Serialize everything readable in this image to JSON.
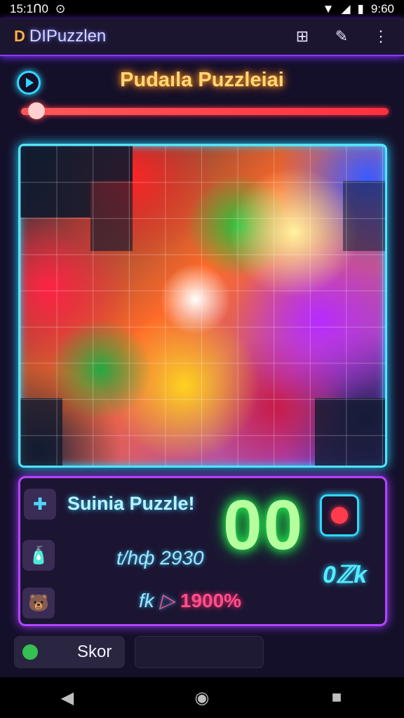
{
  "status_bar": {
    "time": "15:1ᑎ0",
    "right_time": "9:60"
  },
  "app_bar": {
    "logo_text": "D",
    "title": "DIPuzzlen"
  },
  "header": {
    "title": "Pudaıla Puzzleiai"
  },
  "progress": {
    "level": 0.02
  },
  "info_panel": {
    "title": "Suinia Puzzle!",
    "score": "00",
    "line1": "t/hф 2930",
    "line2_prefix": "fk",
    "line2_percent": "1900%",
    "right_value": "0ℤk"
  },
  "footer": {
    "skor_label": "Skor"
  },
  "colors": {
    "accent_cyan": "#2fd8ff",
    "accent_purple": "#b443ff",
    "accent_green": "#29ff55",
    "accent_red": "#ff3344"
  }
}
